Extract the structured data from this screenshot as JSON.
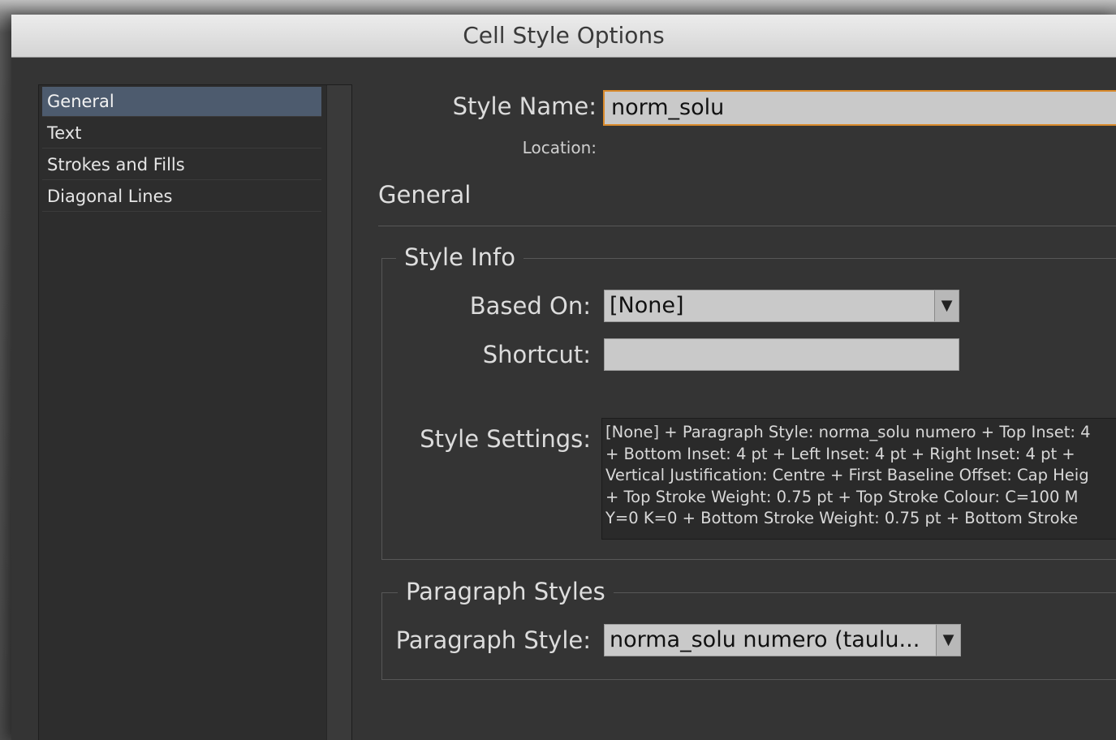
{
  "window": {
    "title": "Cell Style Options"
  },
  "sidebar": {
    "items": [
      {
        "label": "General",
        "selected": true
      },
      {
        "label": "Text",
        "selected": false
      },
      {
        "label": "Strokes and Fills",
        "selected": false
      },
      {
        "label": "Diagonal Lines",
        "selected": false
      }
    ]
  },
  "form": {
    "style_name_label": "Style Name:",
    "style_name_value": "norm_solu",
    "location_label": "Location:",
    "section_title": "General",
    "style_info": {
      "legend": "Style Info",
      "based_on_label": "Based On:",
      "based_on_value": "[None]",
      "shortcut_label": "Shortcut:",
      "shortcut_value": "",
      "style_settings_label": "Style Settings:",
      "style_settings_lines": [
        "[None] + Paragraph Style: norma_solu numero + Top Inset: 4",
        "+ Bottom Inset: 4 pt + Left Inset: 4 pt + Right Inset: 4 pt +",
        "Vertical Justification: Centre + First Baseline Offset: Cap Heig",
        "+ Top Stroke Weight: 0.75 pt + Top Stroke Colour: C=100 M",
        "Y=0 K=0 + Bottom Stroke Weight: 0.75 pt + Bottom Stroke"
      ]
    },
    "paragraph_styles": {
      "legend": "Paragraph Styles",
      "paragraph_style_label": "Paragraph Style:",
      "paragraph_style_value": "norma_solu numero (taulu..."
    }
  },
  "icons": {
    "dropdown_arrow": "▼"
  },
  "colors": {
    "selection": "#4d5b6e",
    "focus_ring": "#d98a2b",
    "dialog_bg": "#343434"
  }
}
